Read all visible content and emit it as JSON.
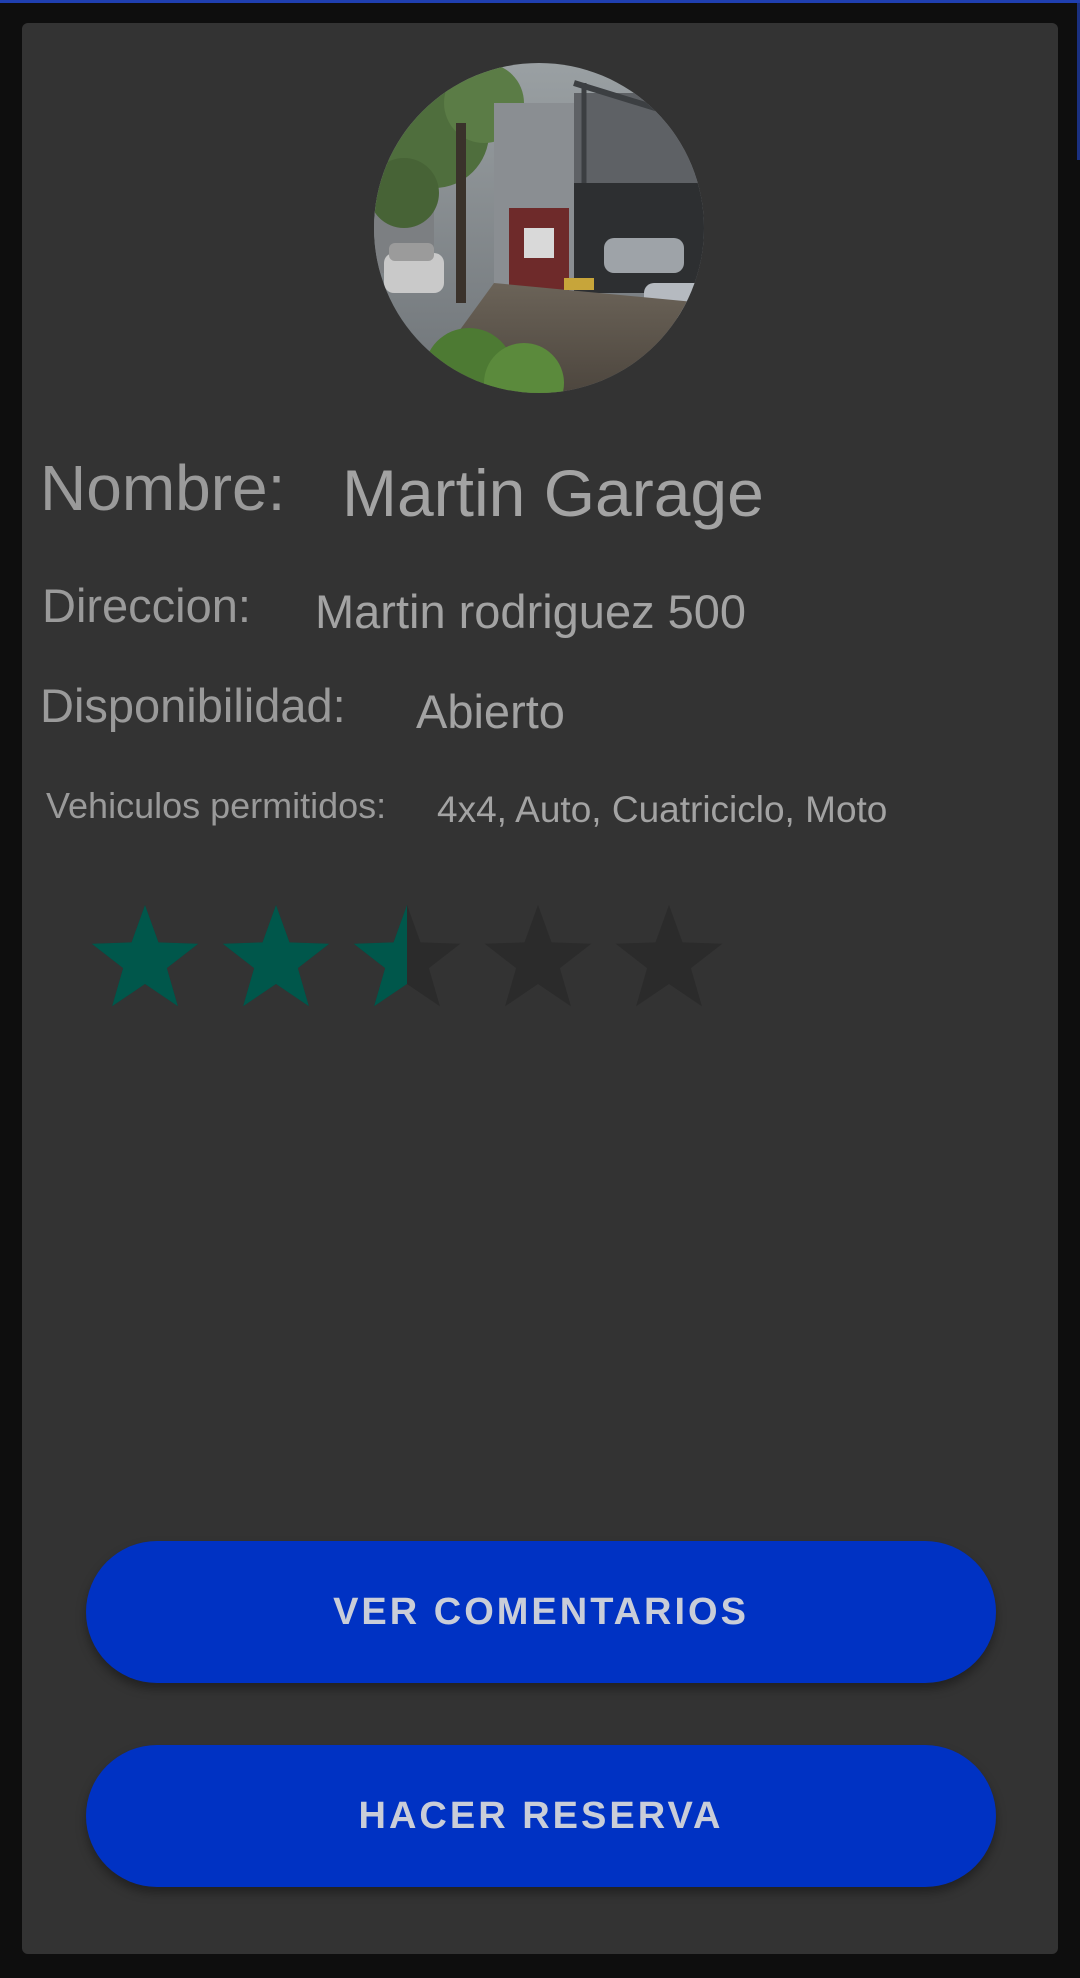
{
  "details": {
    "name_label": "Nombre:",
    "name_value": "Martin Garage",
    "address_label": "Direccion:",
    "address_value": "Martin rodriguez 500",
    "availability_label": "Disponibilidad:",
    "availability_value": "Abierto",
    "vehicles_label": "Vehiculos permitidos:",
    "vehicles_value": "4x4, Auto, Cuatriciclo, Moto"
  },
  "rating": {
    "value": 2.5,
    "max": 5,
    "filled_color": "#00574b",
    "empty_color": "#2b2b2b"
  },
  "actions": {
    "comments_label": "VER COMENTARIOS",
    "reserve_label": "HACER RESERVA"
  },
  "colors": {
    "card_background": "#333333",
    "button_background": "#0032c3",
    "text": "#9a9a9a"
  }
}
